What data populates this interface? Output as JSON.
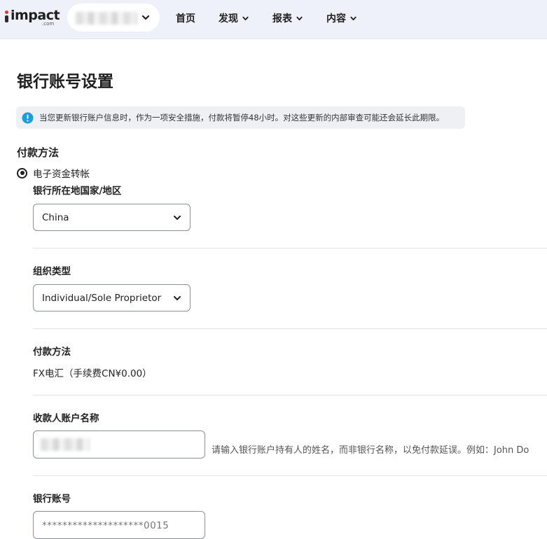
{
  "header": {
    "logo": {
      "word": "impact",
      "sub": ".com"
    },
    "nav": [
      {
        "label": "首页"
      },
      {
        "label": "发现"
      },
      {
        "label": "报表"
      },
      {
        "label": "内容"
      }
    ]
  },
  "page": {
    "title": "银行账号设置",
    "notice": "当您更新银行账户信息时，作为一项安全措施，付款将暂停48小时。对这些更新的内部审查可能还会延长此期限。"
  },
  "payment_method_section": {
    "label": "付款方法",
    "option": "电子资金转帐"
  },
  "fields": {
    "bank_country_label": "银行所在地国家/地区",
    "bank_country_value": "China",
    "org_type_label": "组织类型",
    "org_type_value": "Individual/Sole Proprietor",
    "payment_method_label": "付款方法",
    "payment_method_value": "FX电汇（手续费CN¥0.00）",
    "payee_name_label": "收款人账户名称",
    "payee_name_hint": "请输入银行账户持有人的姓名，而非银行名称，以免付款延误。例如：John Do",
    "account_number_label": "银行账号",
    "account_number_value": "********************0015"
  },
  "colors": {
    "topbar_bg": "#eef1f9",
    "notice_bg": "#eef0f3",
    "info_icon": "#1a9fd9",
    "logo_dot": "#e3362d"
  }
}
